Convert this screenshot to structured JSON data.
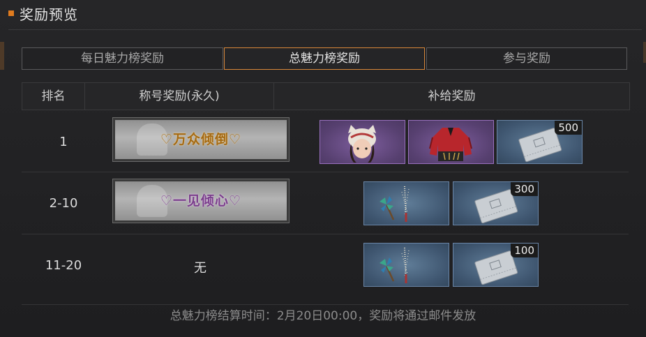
{
  "window": {
    "title": "奖励预览"
  },
  "tabs": [
    {
      "label": "每日魅力榜奖励",
      "active": false
    },
    {
      "label": "总魅力榜奖励",
      "active": true
    },
    {
      "label": "参与奖励",
      "active": false
    }
  ],
  "table": {
    "headers": {
      "rank": "排名",
      "title": "称号奖励(永久)",
      "rewards": "补给奖励"
    },
    "rows": [
      {
        "rank": "1",
        "title_badge": "♡万众倾倒♡",
        "badge_color": "gold",
        "items": [
          {
            "icon": "character-head-icon"
          },
          {
            "icon": "red-jacket-icon"
          },
          {
            "icon": "supply-packet-icon",
            "count": "500"
          }
        ]
      },
      {
        "rank": "2-10",
        "title_badge": "♡一见倾心♡",
        "badge_color": "purple",
        "items": [
          {
            "icon": "pinwheel-firework-icon"
          },
          {
            "icon": "supply-packet-icon",
            "count": "300"
          }
        ]
      },
      {
        "rank": "11-20",
        "title_text": "无",
        "items": [
          {
            "icon": "pinwheel-firework-icon"
          },
          {
            "icon": "supply-packet-icon",
            "count": "100"
          }
        ]
      }
    ]
  },
  "footer": {
    "note": "总魅力榜结算时间：2月20日00:00，奖励将通过邮件发放"
  },
  "colors": {
    "accent": "#e07b1e",
    "active_tab_border": "#d9883a",
    "purple_rarity": "#9a70c0",
    "blue_rarity": "#6a86a8"
  }
}
